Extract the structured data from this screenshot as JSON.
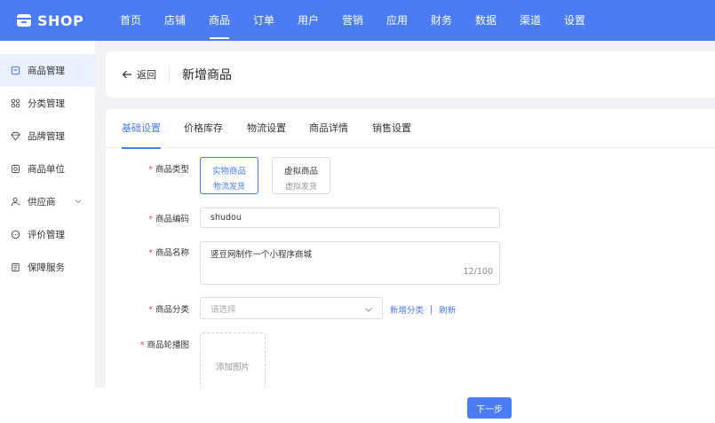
{
  "app": {
    "name": "SHOP"
  },
  "nav": [
    "首页",
    "店铺",
    "商品",
    "订单",
    "用户",
    "营销",
    "应用",
    "财务",
    "数据",
    "渠道",
    "设置"
  ],
  "nav_active_index": 2,
  "sidebar": {
    "items": [
      {
        "label": "商品管理",
        "icon": "bag-icon",
        "active": true
      },
      {
        "label": "分类管理",
        "icon": "grid-icon"
      },
      {
        "label": "品牌管理",
        "icon": "diamond-icon"
      },
      {
        "label": "商品单位",
        "icon": "target-icon"
      },
      {
        "label": "供应商",
        "icon": "user-icon",
        "expandable": true
      },
      {
        "label": "评价管理",
        "icon": "comment-icon"
      },
      {
        "label": "保障服务",
        "icon": "document-icon"
      }
    ]
  },
  "header": {
    "back_label": "返回",
    "title": "新增商品"
  },
  "tabs": [
    "基础设置",
    "价格库存",
    "物流设置",
    "商品详情",
    "销售设置"
  ],
  "tab_active_index": 0,
  "form": {
    "type": {
      "label": "商品类型",
      "options": [
        {
          "title": "实物商品",
          "subtitle": "物流发货",
          "selected": true
        },
        {
          "title": "虚拟商品",
          "subtitle": "虚拟发货",
          "selected": false
        }
      ]
    },
    "code": {
      "label": "商品编码",
      "value": "shudou"
    },
    "name": {
      "label": "商品名称",
      "value": "竖豆网制作一个小程序商城",
      "counter": "12/100"
    },
    "category": {
      "label": "商品分类",
      "placeholder": "请选择",
      "add_link": "新增分类",
      "separator": "|",
      "refresh_link": "刷新"
    },
    "carousel": {
      "label": "商品轮播图",
      "upload_label": "添加图片"
    },
    "required_mark": "*"
  },
  "footer": {
    "next_label": "下一步"
  },
  "colors": {
    "primary": "#4a7cf3",
    "required": "#f0443d",
    "background": "#f0f2f5"
  }
}
